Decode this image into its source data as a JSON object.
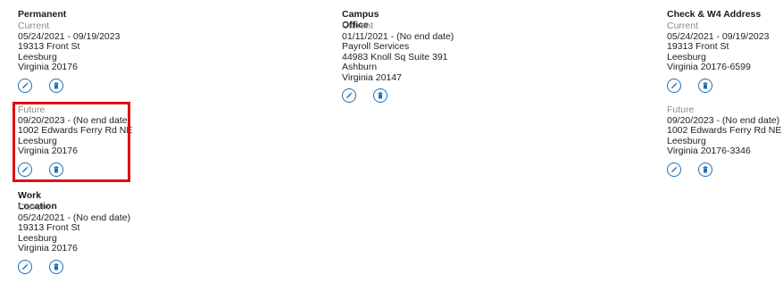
{
  "columns": [
    {
      "sections": [
        {
          "title": "Permanent",
          "entries": [
            {
              "status": "Current",
              "dates": "05/24/2021 - 09/19/2023",
              "street": "19313 Front St",
              "city": "Leesburg",
              "state_zip": "Virginia 20176"
            },
            {
              "status": "Future",
              "dates": "09/20/2023 - (No end date)",
              "street": "1002 Edwards Ferry Rd NE",
              "city": "Leesburg",
              "state_zip": "Virginia 20176"
            }
          ]
        },
        {
          "title": "Work Location",
          "entries": [
            {
              "status": "Current",
              "dates": "05/24/2021 - (No end date)",
              "street": "19313 Front St",
              "city": "Leesburg",
              "state_zip": "Virginia 20176"
            }
          ]
        }
      ]
    },
    {
      "sections": [
        {
          "title": "Campus Office",
          "entries": [
            {
              "status": "Current",
              "dates": "01/11/2021 - (No end date)",
              "line1": "Payroll Services",
              "street": "44983 Knoll Sq Suite 391",
              "city": "Ashburn",
              "state_zip": "Virginia 20147"
            }
          ]
        }
      ]
    },
    {
      "sections": [
        {
          "title": "Check & W4 Address",
          "entries": [
            {
              "status": "Current",
              "dates": "05/24/2021 - 09/19/2023",
              "street": "19313 Front St",
              "city": "Leesburg",
              "state_zip": "Virginia 20176-6599"
            },
            {
              "status": "Future",
              "dates": "09/20/2023 - (No end date)",
              "street": "1002 Edwards Ferry Rd NE",
              "city": "Leesburg",
              "state_zip": "Virginia 20176-3346"
            }
          ]
        }
      ]
    }
  ],
  "icons": {
    "edit": "pencil-icon",
    "delete": "trash-icon"
  },
  "colors": {
    "accent": "#1f6fb5",
    "muted_text": "#8a8a8a",
    "highlight": "#e01010"
  }
}
